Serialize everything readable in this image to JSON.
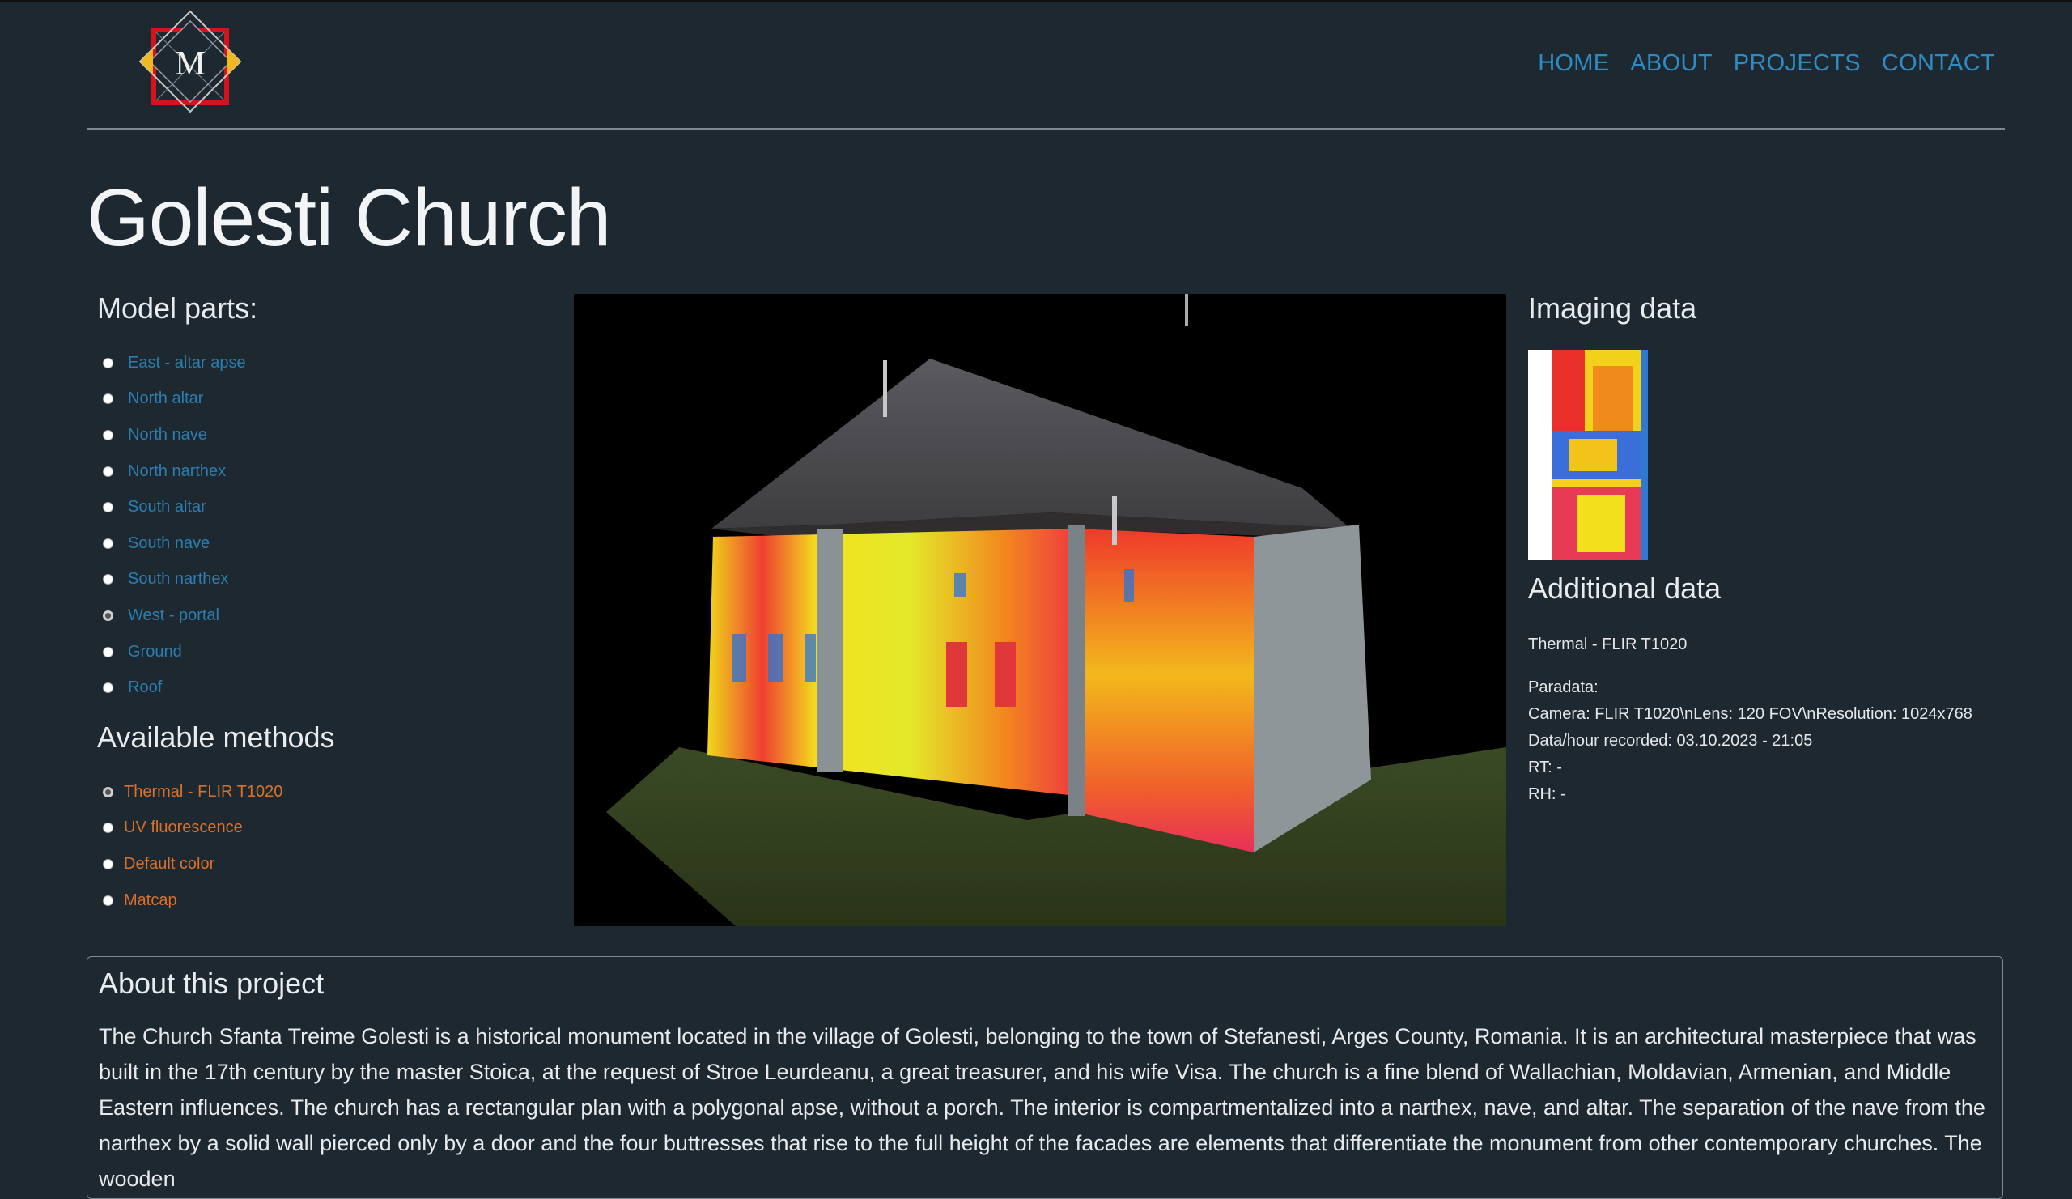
{
  "header": {
    "logo_letter": "M",
    "nav": [
      "HOME",
      "ABOUT",
      "PROJECTS",
      "CONTACT"
    ]
  },
  "page_title": "Golesti Church",
  "model_parts": {
    "title": "Model parts:",
    "items": [
      {
        "label": "East - altar apse",
        "checked": false
      },
      {
        "label": "North altar",
        "checked": false
      },
      {
        "label": "North nave",
        "checked": false
      },
      {
        "label": "North narthex",
        "checked": false
      },
      {
        "label": "South altar",
        "checked": false
      },
      {
        "label": "South nave",
        "checked": false
      },
      {
        "label": "South narthex",
        "checked": false
      },
      {
        "label": "West - portal",
        "checked": true
      },
      {
        "label": "Ground",
        "checked": false
      },
      {
        "label": "Roof",
        "checked": false
      }
    ]
  },
  "methods": {
    "title": "Available methods",
    "items": [
      {
        "label": "Thermal - FLIR T1020",
        "checked": true
      },
      {
        "label": "UV fluorescence",
        "checked": false
      },
      {
        "label": "Default color",
        "checked": false
      },
      {
        "label": "Matcap",
        "checked": false
      }
    ]
  },
  "imaging": {
    "title": "Imaging data",
    "additional_title": "Additional data",
    "method_name": "Thermal - FLIR T1020",
    "paradata_label": "Paradata:",
    "camera": "Camera: FLIR T1020\\nLens: 120 FOV\\nResolution: 1024x768",
    "recorded": "Data/hour recorded: 03.10.2023 - 21:05",
    "rt": "RT: -",
    "rh": "RH: -"
  },
  "about": {
    "title": "About this project",
    "text": "The Church Sfanta Treime Golesti is a historical monument located in the village of Golesti, belonging to the town of Stefanesti, Arges County, Romania. It is an architectural masterpiece that was built in the 17th century by the master Stoica, at the request of Stroe Leurdeanu, a great treasurer, and his wife Visa. The church is a fine blend of Wallachian, Moldavian, Armenian, and Middle Eastern influences. The church has a rectangular plan with a polygonal apse, without a porch. The interior is compartmentalized into a narthex, nave, and altar. The separation of the nave from the narthex by a solid wall pierced only by a door and the four buttresses that rise to the full height of the facades are elements that differentiate the monument from other contemporary churches. The wooden"
  },
  "colors": {
    "background": "#1e2830",
    "nav_link": "#2e8bc3",
    "part_link": "#2a7eb0",
    "method_link": "#d8722b"
  }
}
